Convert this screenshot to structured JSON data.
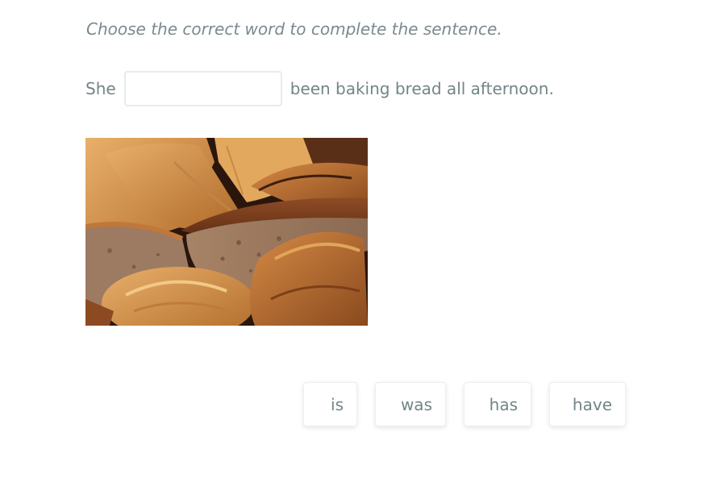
{
  "exercise": {
    "instruction": "Choose the correct word to complete the sentence.",
    "sentence_before": "She",
    "sentence_after": "been baking bread all afternoon.",
    "blank_value": "",
    "blank_placeholder": ""
  },
  "image": {
    "icon": "bread-photo"
  },
  "options": [
    {
      "label": "is"
    },
    {
      "label": "was"
    },
    {
      "label": "has"
    },
    {
      "label": "have"
    }
  ],
  "colors": {
    "text": "#738488",
    "instruction": "#7a8a8e",
    "border": "#e8ebec",
    "background": "#ffffff"
  }
}
